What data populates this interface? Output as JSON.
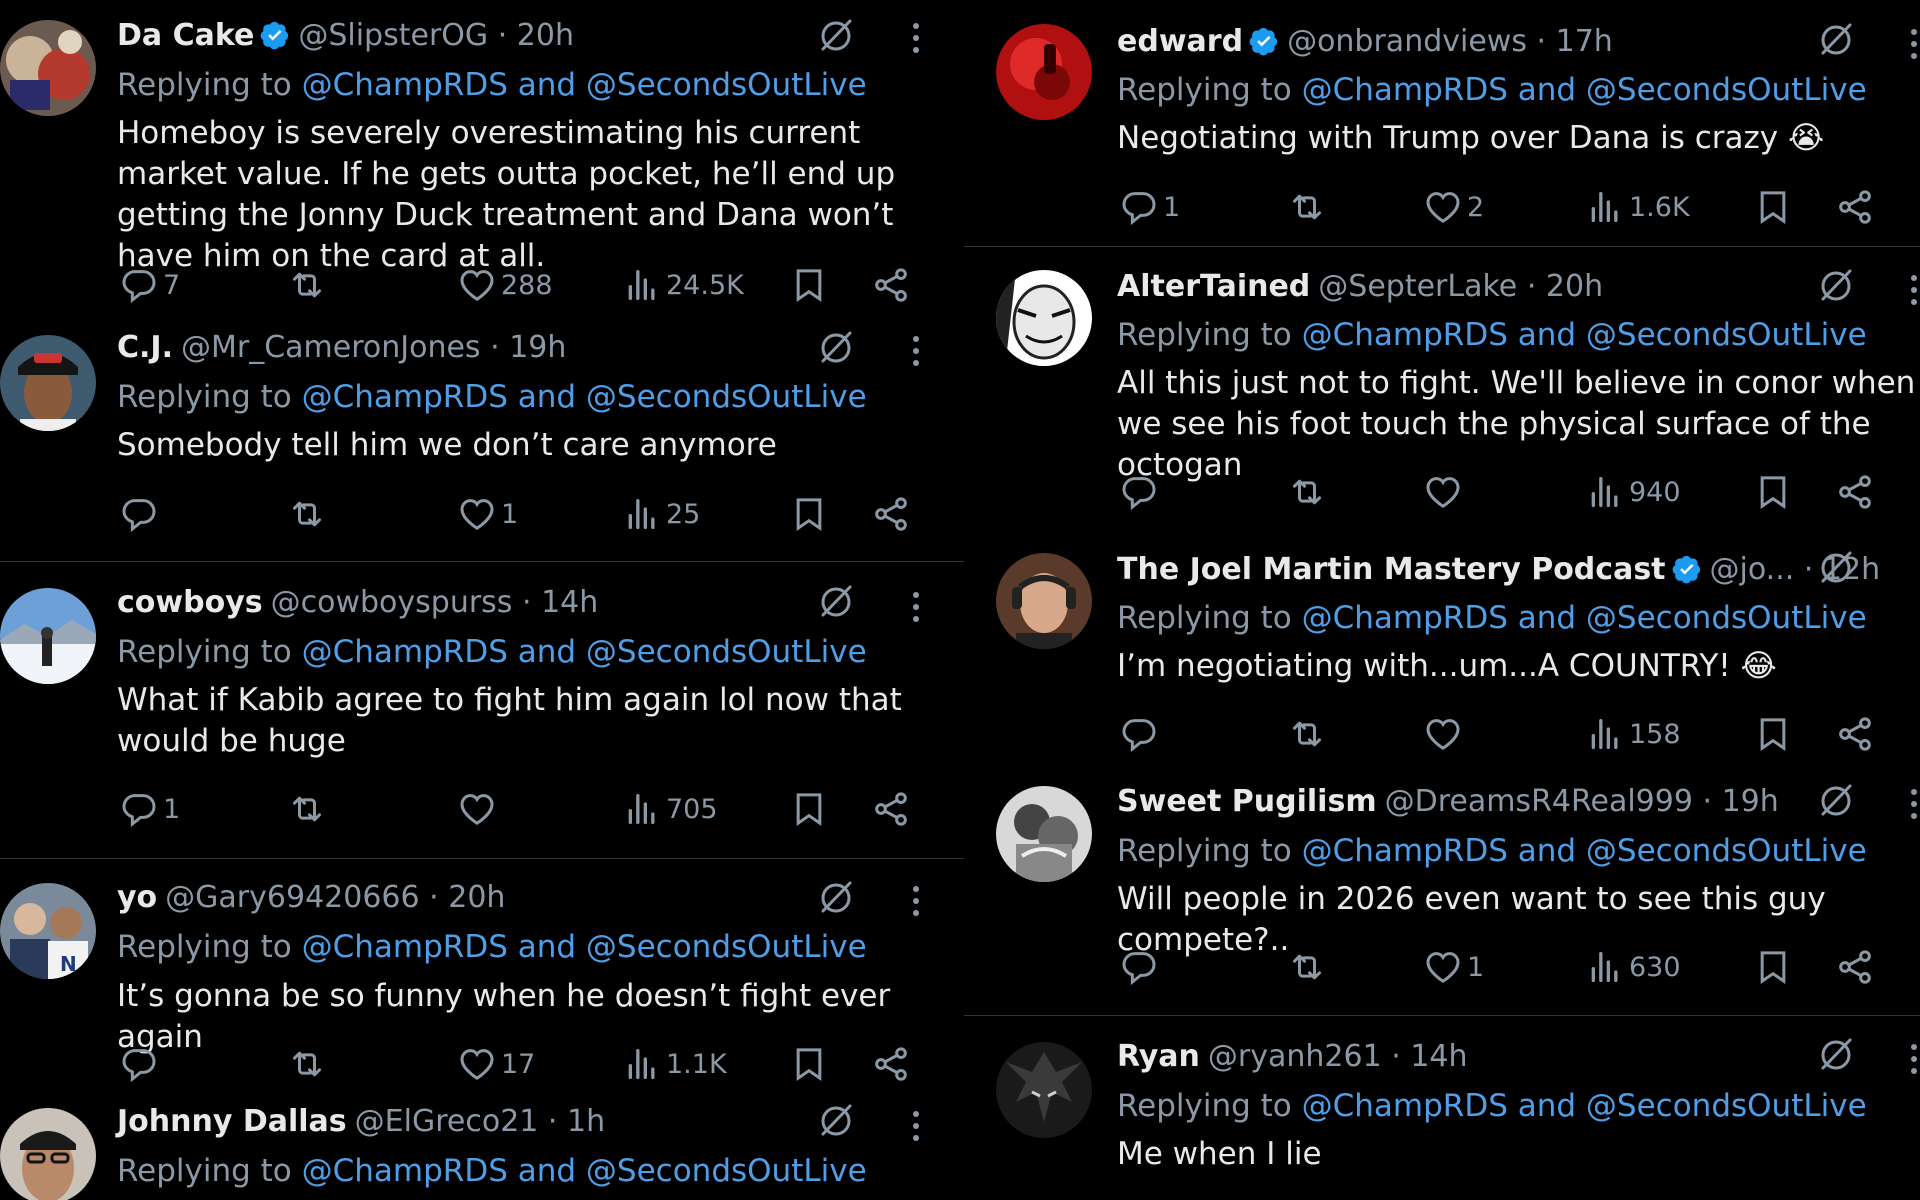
{
  "reply_prefix": "Replying to",
  "reply_mentions": "@ChampRDS and @SecondsOutLive",
  "left": [
    {
      "name": "Da Cake",
      "verified": true,
      "handle": "@SlipsterOG",
      "sep": "·",
      "time": "20h",
      "text": "Homeboy is severely overestimating his current market value. If he gets outta pocket, he’ll end up getting the Jonny Duck treatment and Dana won’t have him on the card at all.",
      "replies": "7",
      "reposts": "",
      "likes": "288",
      "views": "24.5K"
    },
    {
      "name": "C.J.",
      "verified": false,
      "handle": "@Mr_CameronJones",
      "sep": "·",
      "time": "19h",
      "text": "Somebody tell him we don’t care anymore",
      "replies": "",
      "reposts": "",
      "likes": "1",
      "views": "25"
    },
    {
      "name": "cowboys",
      "verified": false,
      "handle": "@cowboyspurss",
      "sep": "·",
      "time": "14h",
      "text": "What if Kabib agree to fight him again lol now that would be huge",
      "replies": "1",
      "reposts": "",
      "likes": "",
      "views": "705"
    },
    {
      "name": "yo",
      "verified": false,
      "handle": "@Gary69420666",
      "sep": "·",
      "time": "20h",
      "text": "It’s gonna be so funny when he doesn’t fight ever again",
      "replies": "",
      "reposts": "",
      "likes": "17",
      "views": "1.1K"
    },
    {
      "name": "Johnny Dallas",
      "verified": false,
      "handle": "@ElGreco21",
      "sep": "·",
      "time": "1h",
      "text": "",
      "replies": "",
      "reposts": "",
      "likes": "",
      "views": ""
    }
  ],
  "right": [
    {
      "name": "edward",
      "verified": true,
      "handle": "@onbrandviews",
      "sep": "·",
      "time": "17h",
      "text": "Negotiating with Trump over Dana is crazy 😭",
      "replies": "1",
      "reposts": "",
      "likes": "2",
      "views": "1.6K"
    },
    {
      "name": "AlterTained",
      "verified": false,
      "handle": "@SepterLake",
      "sep": "·",
      "time": "20h",
      "text": "All this just not to fight. We'll believe in conor when we see his foot touch the physical surface of the octogan",
      "replies": "",
      "reposts": "",
      "likes": "",
      "views": "940"
    },
    {
      "name": "The Joel Martin Mastery Podcast",
      "verified": true,
      "handle": "@jo...",
      "sep": "·",
      "time": "12h",
      "text": "I’m negotiating with...um...A COUNTRY! 😂",
      "replies": "",
      "reposts": "",
      "likes": "",
      "views": "158"
    },
    {
      "name": "Sweet Pugilism",
      "verified": false,
      "handle": "@DreamsR4Real999",
      "sep": "·",
      "time": "19h",
      "text": "Will people in 2026 even want to see this guy compete?..",
      "replies": "",
      "reposts": "",
      "likes": "1",
      "views": "630"
    },
    {
      "name": "Ryan",
      "verified": false,
      "handle": "@ryanh261",
      "sep": "·",
      "time": "14h",
      "text": "Me when I lie",
      "replies": "",
      "reposts": "",
      "likes": "",
      "views": ""
    }
  ],
  "icons": {
    "reply": "reply-icon",
    "repost": "repost-icon",
    "like": "like-icon",
    "views": "views-icon",
    "bookmark": "bookmark-icon",
    "share": "share-icon",
    "grok": "grok-icon",
    "more": "more-icon",
    "verified": "verified-badge-icon"
  },
  "colors": {
    "background": "#000000",
    "text": "#e7e9ea",
    "muted": "#8b98a5",
    "mention": "#4f9ee8",
    "verified": "#1d9bf0",
    "divider": "#2f3336"
  }
}
